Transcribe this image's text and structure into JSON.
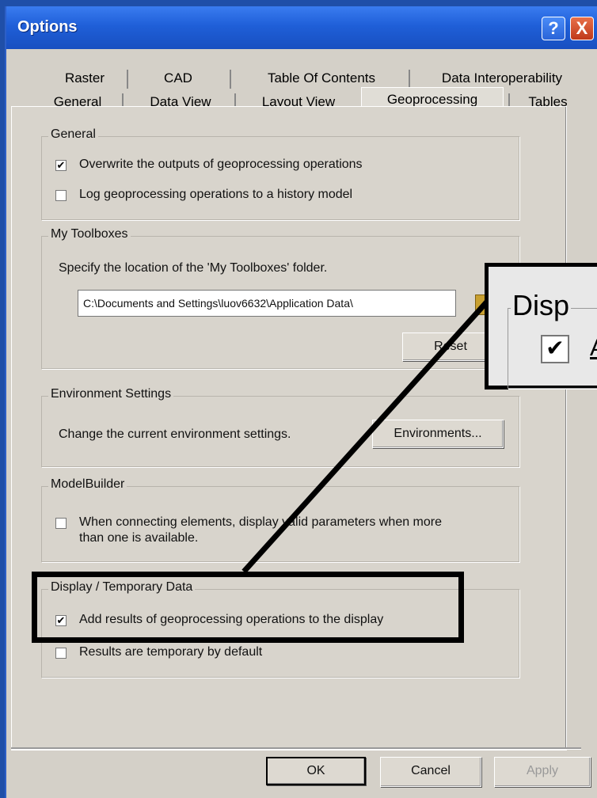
{
  "window": {
    "title": "Options"
  },
  "titlebar_buttons": {
    "help": "?",
    "close": "X"
  },
  "tabs_row1": [
    "Raster",
    "CAD",
    "Table Of Contents",
    "Data Interoperability"
  ],
  "tabs_row2": [
    "General",
    "Data View",
    "Layout View",
    "Geoprocessing",
    "Tables"
  ],
  "active_tab": "Geoprocessing",
  "general": {
    "legend": "General",
    "overwrite": {
      "label": "Overwrite the outputs of geoprocessing operations",
      "checked": true
    },
    "log": {
      "label": "Log geoprocessing operations to a history model",
      "checked": false
    }
  },
  "toolboxes": {
    "legend": "My Toolboxes",
    "description": "Specify the location of the 'My Toolboxes' folder.",
    "path": "C:\\Documents and Settings\\luov6632\\Application Data\\",
    "reset_label": "Reset"
  },
  "environment": {
    "legend": "Environment Settings",
    "description": "Change the current environment settings.",
    "button_label": "Environments..."
  },
  "modelbuilder": {
    "legend": "ModelBuilder",
    "option": {
      "line1": "When connecting elements, display valid parameters when more",
      "line2": "than one is available.",
      "checked": false
    }
  },
  "display": {
    "legend": "Display / Temporary Data",
    "add_results": {
      "label": "Add results of geoprocessing operations to the display",
      "checked": true
    },
    "temporary": {
      "label": "Results are temporary by default",
      "checked": false
    }
  },
  "callout": {
    "legend": "Disp",
    "check": "✔",
    "fragment": "A"
  },
  "buttons": {
    "ok": "OK",
    "cancel": "Cancel",
    "apply": "Apply"
  },
  "check_glyph": "✔"
}
